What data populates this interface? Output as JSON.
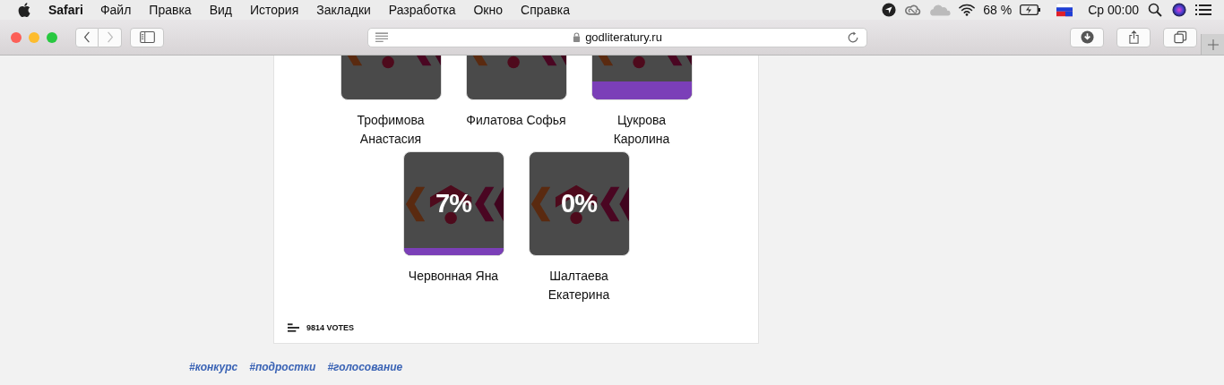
{
  "menu_bar": {
    "app": "Safari",
    "menus": [
      "Файл",
      "Правка",
      "Вид",
      "История",
      "Закладки",
      "Разработка",
      "Окно",
      "Справка"
    ],
    "battery": "68 %",
    "clock": "Ср 00:00"
  },
  "toolbar": {
    "back_disabled": false,
    "forward_disabled": true,
    "address": "godliteratury.ru"
  },
  "poll": {
    "rows": [
      [
        {
          "name": "Трофимова Анастасия"
        },
        {
          "name": "Филатова Софья"
        },
        {
          "name": "Цукрова Каролина",
          "level": 0.17
        }
      ],
      [
        {
          "name": "Червонная Яна",
          "percent": "7%",
          "level": 0.07
        },
        {
          "name": "Шалтаева Екатерина",
          "percent": "0%"
        }
      ]
    ],
    "votes": "9814 VOTES"
  },
  "tags": [
    "#конкурс",
    "#подростки",
    "#голосование"
  ]
}
